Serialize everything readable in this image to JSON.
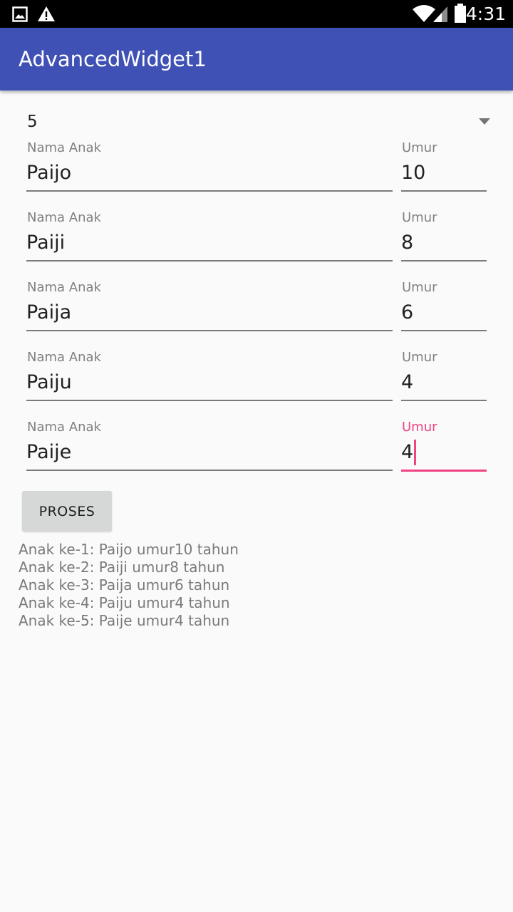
{
  "status_bar": {
    "time": "4:31",
    "icons": [
      "image-icon",
      "warning-icon",
      "wifi-icon",
      "signal-icon",
      "battery-icon"
    ]
  },
  "app_bar": {
    "title": "AdvancedWidget1",
    "color": "#3f51b5"
  },
  "spinner": {
    "selected": "5"
  },
  "rows": [
    {
      "name_label": "Nama Anak",
      "name_value": "Paijo",
      "age_label": "Umur",
      "age_value": "10"
    },
    {
      "name_label": "Nama Anak",
      "name_value": "Paiji",
      "age_label": "Umur",
      "age_value": "8"
    },
    {
      "name_label": "Nama Anak",
      "name_value": "Paija",
      "age_label": "Umur",
      "age_value": "6"
    },
    {
      "name_label": "Nama Anak",
      "name_value": "Paiju",
      "age_label": "Umur",
      "age_value": "4"
    },
    {
      "name_label": "Nama Anak",
      "name_value": "Paije",
      "age_label": "Umur",
      "age_value": "4"
    }
  ],
  "focus_color": "#ee4483",
  "button": {
    "label": "PROSES"
  },
  "results": [
    "Anak ke-1: Paijo umur10 tahun",
    "Anak ke-2: Paiji umur8 tahun",
    "Anak ke-3: Paija umur6 tahun",
    "Anak ke-4: Paiju umur4 tahun",
    "Anak ke-5: Paije umur4 tahun"
  ]
}
